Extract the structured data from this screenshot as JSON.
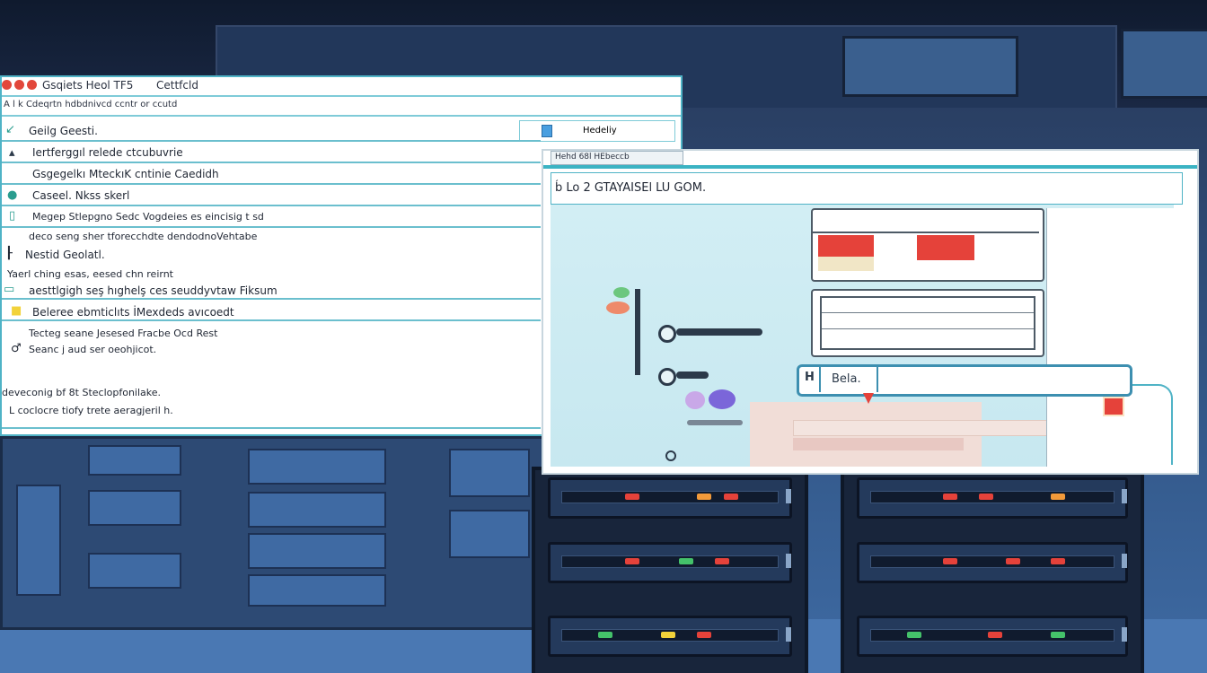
{
  "window1": {
    "title": "Gsqiets Heol TF5",
    "title2": "Cettfcld",
    "menubar_text": "A l k Cdeqrtn hdbdnivcd ccntr or ccutd",
    "header_box_label": "Hedeliy",
    "rows": [
      {
        "label": "Geilg     Geesti.",
        "icon": "↙"
      },
      {
        "label": "Iertferggıl  relede  ctcubuvrie",
        "icon": "▴"
      },
      {
        "label": "Gsgegelkı MteckıK cntinie Caedidh",
        "icon": ""
      },
      {
        "label": "Caseel. Nkss skerl",
        "icon": "●"
      },
      {
        "label": "Megep Stlepgno   Sedc Vogdeies es eincisig t sd",
        "icon": "▯"
      },
      {
        "label": "deco seng sher tforecchdte dendodnoVehtabe",
        "icon": ""
      },
      {
        "label": "Nestid Geolatl.",
        "icon": "┠"
      },
      {
        "label": "Yaerl ching esas, eesed chn reirnt",
        "icon": ""
      },
      {
        "label": "aesttlgigh seş hıghelş ces seuddyvtaw Fiksum",
        "icon": "▭"
      },
      {
        "label": "Beleree ebmticlıts İMexdeds avıcoedt",
        "icon": "■"
      },
      {
        "label": "Tecteg seane  Jesesed  Fracbe Ocd Rest",
        "icon": ""
      },
      {
        "label": "Seanc j aud ser oeohjicot.",
        "icon": "♂"
      },
      {
        "label": "deveconig bf 8t  Steclopfonilake.",
        "icon": ""
      },
      {
        "label": "L  coclocre tiofy trete aeragjeril h.",
        "icon": ""
      }
    ]
  },
  "window2": {
    "strip_text": "Hehd 68l  HEbeccb",
    "address_text": "b́ Lo  2 GTAYAISEl  LU     GOM.",
    "input_prefix": "H",
    "input_text": "Bela.",
    "colors": {
      "accent": "#3bb3c3",
      "red": "#e5423a",
      "border": "#4d5a66"
    }
  },
  "icons": [
    "close-dot-icon",
    "minimize-dot-icon",
    "maximize-dot-icon",
    "folder-icon",
    "warning-icon",
    "arrow-icon",
    "server-rack-icon"
  ]
}
